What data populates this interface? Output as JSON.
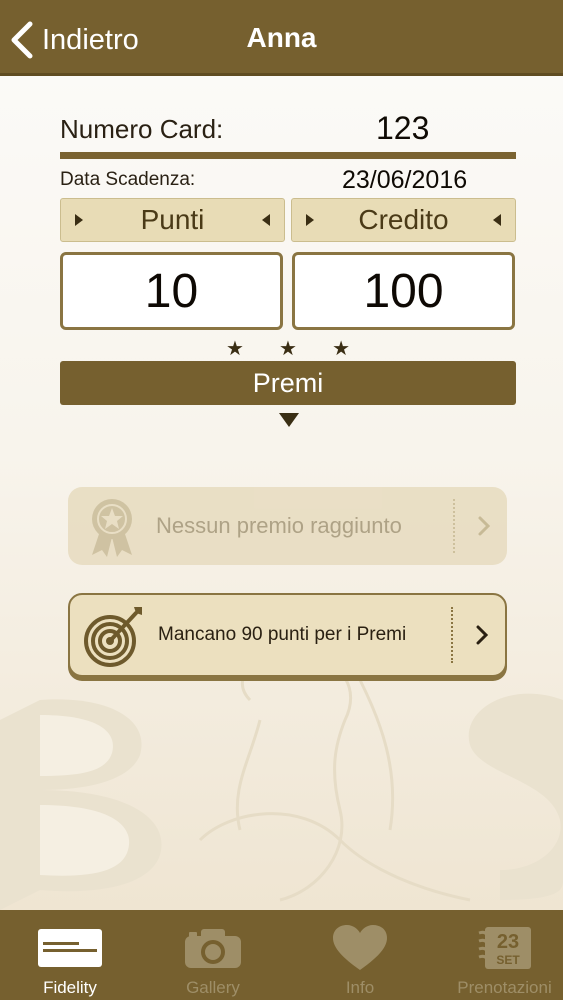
{
  "header": {
    "back_label": "Indietro",
    "title": "Anna"
  },
  "card": {
    "number_label": "Numero Card:",
    "number_value": "123",
    "expiry_label": "Data Scadenza:",
    "expiry_value": "23/06/2016"
  },
  "tabs": {
    "points_label": "Punti",
    "credit_label": "Credito"
  },
  "values": {
    "points": "10",
    "credit": "100"
  },
  "rewards": {
    "label": "Premi",
    "panels": [
      {
        "text": "Nessun premio raggiunto",
        "icon": "ribbon-award-icon"
      },
      {
        "text": "Mancano 90 punti per i Premi",
        "icon": "target-arrow-icon"
      }
    ]
  },
  "tabbar": {
    "items": [
      {
        "label": "Fidelity",
        "icon": "card-icon",
        "active": true
      },
      {
        "label": "Gallery",
        "icon": "camera-icon",
        "active": false
      },
      {
        "label": "Info",
        "icon": "heart-icon",
        "active": false
      },
      {
        "label": "Prenotazioni",
        "icon": "calendar-icon",
        "active": false
      }
    ],
    "calendar_day": "23",
    "calendar_month": "SET"
  },
  "colors": {
    "brand": "#76602f",
    "tab_bg": "#e8dcb6",
    "background": "#f6f1e6"
  }
}
